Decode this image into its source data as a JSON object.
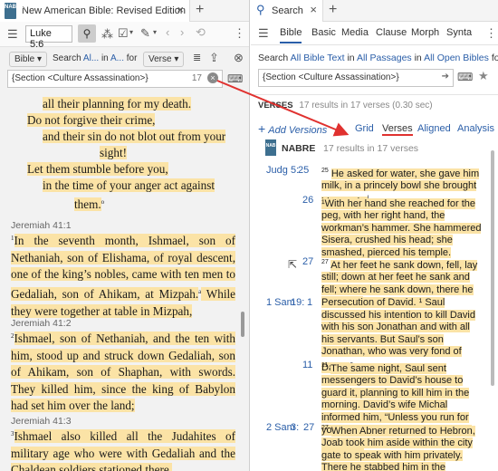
{
  "left": {
    "tab_title": "New American Bible: Revised Edition",
    "tab_icon": "NABRE",
    "reference": "Luke 5:6",
    "search_row": {
      "bible_label": "Bible",
      "search_label": "Search",
      "all_label": "Al...",
      "in_label": "in",
      "a_label": "A...",
      "for_label": "for",
      "verse_label": "Verse"
    },
    "query": "{Section <Culture Assassination>}",
    "count": "17",
    "poetry": [
      "all their planning for my death.",
      "Do not forgive their crime,",
      "and their sin do not blot out from your",
      "sight!",
      "Let them stumble before you,",
      "in the time of your anger act against",
      "them."
    ],
    "poetry_note": "o",
    "sections": [
      {
        "head": "Jeremiah 41:1",
        "verse": "1",
        "text": "In the seventh month, Ishmael, son of Nethaniah, son of Elishama, of royal descent, one of the king’s nobles, came with ten men to Gedaliah, son of Ahikam, at Mizpah.",
        "note": "a",
        "tail": " While they were together at table in Mizpah,"
      },
      {
        "head": "Jeremiah 41:2",
        "verse": "2",
        "text": "Ishmael, son of Nethaniah, and the ten with him, stood up and struck down Gedaliah, son of Ahikam, son of Shaphan, with swords. They killed him, since the king of Babylon had set him over the land;"
      },
      {
        "head": "Jeremiah 41:3",
        "verse": "3",
        "text": "Ishmael also killed all the Judahites of military age who were with Gedaliah and the Chaldean soldiers stationed there."
      }
    ]
  },
  "right": {
    "tab_title": "Search",
    "search_tabs": [
      "Bible",
      "Basic",
      "Media",
      "Clause",
      "Morph",
      "Synta"
    ],
    "description": {
      "p1": "Search ",
      "l1": "All Bible Text",
      "p2": " in ",
      "l2": "All Passages",
      "p3": " in ",
      "l3": "All Open Bibles",
      "p4": " for"
    },
    "query": "{Section <Culture Assassination>}",
    "verses_label": "VERSES",
    "verses_info": "17 results in 17 verses (0.30 sec)",
    "add_versions": "Add Versions",
    "view_tabs": [
      "Grid",
      "Verses",
      "Aligned",
      "Analysis"
    ],
    "active_view": "Verses",
    "bible_name": "NABRE",
    "bible_icon": "NAB",
    "bible_results": "17 results in 17 verses",
    "results": [
      {
        "book": "Judg",
        "chap": "5:",
        "verse": "25",
        "num": "25",
        "text": "He asked for water, she gave him milk, in a princely bowl she brought him curds.",
        "note": "l"
      },
      {
        "book": "",
        "chap": "",
        "verse": "26",
        "num": "",
        "text": "¹With her hand she reached for the peg, with her right hand, the workman’s hammer. She hammered Sisera, crushed his head; she smashed, pierced his temple."
      },
      {
        "book": "",
        "chap": "",
        "verse": "27",
        "num": "27",
        "text": "At her feet he sank down, fell, lay still; down at her feet he sank and fell; where he sank down, there he fell, slain."
      },
      {
        "book": "1 Sam",
        "chap": "19:",
        "verse": "1",
        "num": "",
        "text": "Persecution of David. ¹ Saul discussed his intention to kill David with his son Jonathan and with all his servants. But Saul’s son Jonathan, who was very fond of David,",
        "note": "a"
      },
      {
        "book": "",
        "chap": "",
        "verse": "11",
        "num": "11",
        "text": "The same night, Saul sent messengers to David’s house to guard it, planning to kill him in the morning. David’s wife Michal informed him, “Unless you run for your life tonight, tomorrow you will be killed.”",
        "note": "e"
      },
      {
        "book": "2 Sam",
        "chap": "3:",
        "verse": "27",
        "num": "27",
        "text": "When Abner returned to Hebron, Joab took him aside within the city gate to speak with him privately. There he stabbed him in the abdomen, and he died"
      }
    ]
  },
  "colors": {
    "highlight": "#fbe3a6",
    "link": "#2a5ea8",
    "arrow": "#e0312f"
  }
}
